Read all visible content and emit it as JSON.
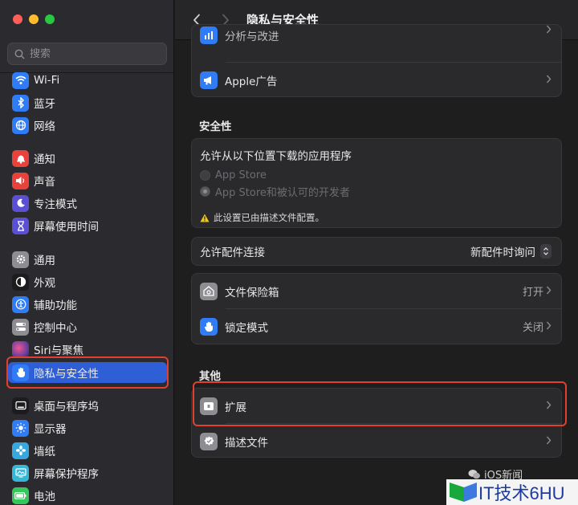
{
  "window": {
    "title": "隐私与安全性"
  },
  "search": {
    "placeholder": "搜索"
  },
  "sidebar": {
    "items": [
      {
        "label": "Wi-Fi",
        "icon": "wifi-icon",
        "color": "#2f7cf6"
      },
      {
        "label": "蓝牙",
        "icon": "bluetooth-icon",
        "color": "#2f7cf6"
      },
      {
        "label": "网络",
        "icon": "globe-icon",
        "color": "#2f7cf6"
      },
      {
        "label": "通知",
        "icon": "bell-icon",
        "color": "#e8423b"
      },
      {
        "label": "声音",
        "icon": "speaker-icon",
        "color": "#e8423b"
      },
      {
        "label": "专注模式",
        "icon": "moon-icon",
        "color": "#5b4fd6"
      },
      {
        "label": "屏幕使用时间",
        "icon": "hourglass-icon",
        "color": "#5b4fd6"
      },
      {
        "label": "通用",
        "icon": "gear-icon",
        "color": "#8e8d92"
      },
      {
        "label": "外观",
        "icon": "appearance-icon",
        "color": "#1c1c1e"
      },
      {
        "label": "辅助功能",
        "icon": "accessibility-icon",
        "color": "#2f7cf6"
      },
      {
        "label": "控制中心",
        "icon": "toggles-icon",
        "color": "#8e8d92"
      },
      {
        "label": "Siri与聚焦",
        "icon": "siri-icon",
        "color": "#6b3fa0"
      },
      {
        "label": "隐私与安全性",
        "icon": "hand-icon",
        "color": "#2f7cf6"
      },
      {
        "label": "桌面与程序坞",
        "icon": "dock-icon",
        "color": "#1c1c1e"
      },
      {
        "label": "显示器",
        "icon": "sun-icon",
        "color": "#2f7cf6"
      },
      {
        "label": "墙纸",
        "icon": "flower-icon",
        "color": "#35a8e0"
      },
      {
        "label": "屏幕保护程序",
        "icon": "screensaver-icon",
        "color": "#35b8d8"
      },
      {
        "label": "电池",
        "icon": "battery-icon",
        "color": "#34c759"
      }
    ]
  },
  "main": {
    "top_card": {
      "partial_row_label": "分析与改进",
      "apple_ads_label": "Apple广告"
    },
    "security_section": {
      "heading": "安全性",
      "allow_download_label": "允许从以下位置下载的应用程序",
      "option_app_store": "App Store",
      "option_app_store_identified": "App Store和被认可的开发者",
      "profile_notice": "此设置已由描述文件配置。"
    },
    "accessory": {
      "label": "允许配件连接",
      "value": "新配件时询问"
    },
    "filevault": {
      "label": "文件保险箱",
      "value": "打开"
    },
    "lockdown": {
      "label": "锁定模式",
      "value": "关闭"
    },
    "other_section": {
      "heading": "其他",
      "extensions_label": "扩展",
      "profiles_label": "描述文件"
    }
  },
  "watermark": {
    "wechat_text": "iOS新闻",
    "site_text": "IT技术6HU"
  },
  "colors": {
    "accent": "#2f5fd6",
    "highlight_frame": "#e0412f"
  }
}
